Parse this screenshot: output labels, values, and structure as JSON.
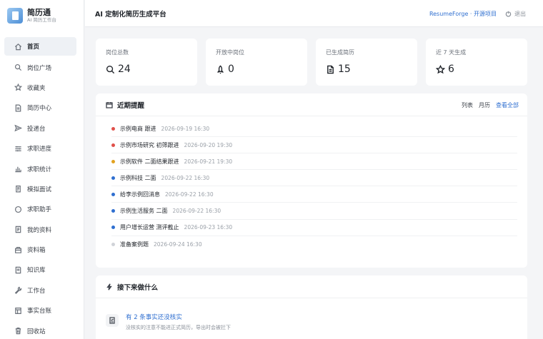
{
  "brand": {
    "name": "简历通",
    "subtitle": "AI 简历工作台"
  },
  "nav": [
    {
      "label": "首页",
      "icon": "home-icon",
      "active": true
    },
    {
      "label": "岗位广场",
      "icon": "search-icon"
    },
    {
      "label": "收藏夹",
      "icon": "star-icon"
    },
    {
      "label": "简历中心",
      "icon": "document-icon"
    },
    {
      "label": "投递台",
      "icon": "send-icon"
    },
    {
      "label": "求职进度",
      "icon": "progress-icon"
    },
    {
      "label": "求职统计",
      "icon": "bar-chart-icon"
    },
    {
      "label": "模拟面试",
      "icon": "clipboard-icon"
    },
    {
      "label": "求职助手",
      "icon": "chat-icon"
    },
    {
      "label": "我的资料",
      "icon": "id-card-icon"
    },
    {
      "label": "资料箱",
      "icon": "box-icon"
    },
    {
      "label": "知识库",
      "icon": "book-icon"
    },
    {
      "label": "工作台",
      "icon": "wrench-icon"
    },
    {
      "label": "事实台账",
      "icon": "ledger-icon"
    },
    {
      "label": "回收站",
      "icon": "trash-icon"
    }
  ],
  "topbar": {
    "title": "AI 定制化简历生成平台",
    "project_link": "ResumeForge · 开源项目",
    "logout": "退出"
  },
  "stats": [
    {
      "label": "岗位总数",
      "value": "24",
      "icon": "search-icon"
    },
    {
      "label": "开放中岗位",
      "value": "0",
      "icon": "rocket-icon"
    },
    {
      "label": "已生成简历",
      "value": "15",
      "icon": "document-icon"
    },
    {
      "label": "近 7 天生成",
      "value": "6",
      "icon": "star-icon"
    }
  ],
  "reminders": {
    "title": "近期提醒",
    "view_list": "列表",
    "view_calendar": "月历",
    "view_all": "查看全部",
    "items": [
      {
        "title": "示例电商 跟进",
        "time": "2026-09-19 16:30",
        "color": "#e0504a"
      },
      {
        "title": "示例市场研究 初筛跟进",
        "time": "2026-09-20 19:30",
        "color": "#e0504a"
      },
      {
        "title": "示例软件 二面结果跟进",
        "time": "2026-09-21 19:30",
        "color": "#e2a21f"
      },
      {
        "title": "示例科技 二面",
        "time": "2026-09-22 16:30",
        "color": "#2f6fd0"
      },
      {
        "title": "给李示例回消息",
        "time": "2026-09-22 16:30",
        "color": "#2f6fd0"
      },
      {
        "title": "示例生活服务 二面",
        "time": "2026-09-22 16:30",
        "color": "#2f6fd0"
      },
      {
        "title": "用户增长运营 测评截止",
        "time": "2026-09-23 16:30",
        "color": "#2f6fd0"
      },
      {
        "title": "准备案例题",
        "time": "2026-09-24 16:30",
        "color": "#d0d3d8"
      }
    ]
  },
  "next": {
    "title": "接下来做什么",
    "items": [
      {
        "title": "有 2 条事实还没核实",
        "desc": "没核实的注意不能进正式简历，导出时会被拦下",
        "icon": "checklist-icon"
      }
    ]
  }
}
